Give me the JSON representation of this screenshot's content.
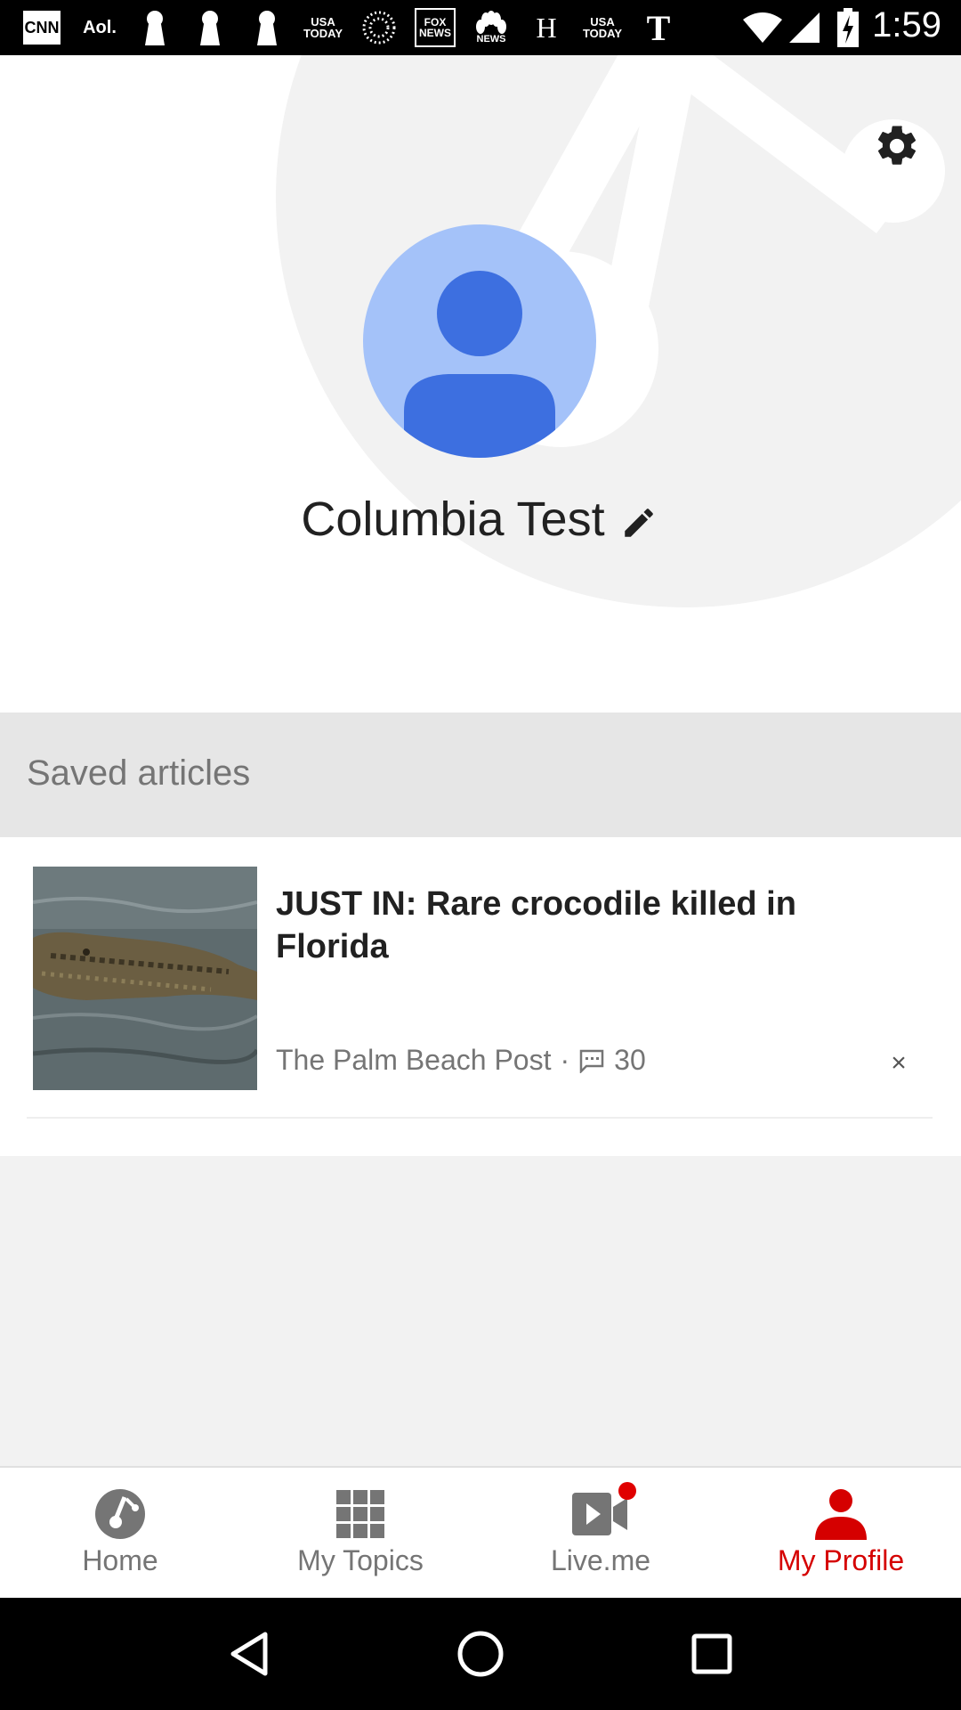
{
  "status_bar": {
    "time": "1:59",
    "notification_icons": [
      "CNN",
      "Aol.",
      "USA TODAY",
      "FOX NEWS",
      "NEWS",
      "H",
      "USA TODAY"
    ]
  },
  "profile": {
    "user_name": "Columbia Test"
  },
  "saved_section": {
    "title": "Saved articles"
  },
  "articles": [
    {
      "headline": "JUST IN: Rare crocodile killed in Florida",
      "source": "The Palm Beach Post",
      "separator": "·",
      "comment_count": "30",
      "dismiss_label": "×"
    }
  ],
  "bottom_nav": {
    "items": [
      {
        "label": "Home",
        "icon": "home-logo-icon",
        "active": false
      },
      {
        "label": "My Topics",
        "icon": "grid-icon",
        "active": false
      },
      {
        "label": "Live.me",
        "icon": "video-camera-icon",
        "active": false
      },
      {
        "label": "My Profile",
        "icon": "person-icon",
        "active": true
      }
    ]
  },
  "colors": {
    "accent_red": "#d50000",
    "avatar_bg": "#a4c2f9",
    "avatar_fg": "#3d6fe0",
    "section_bg": "#e6e6e6"
  }
}
